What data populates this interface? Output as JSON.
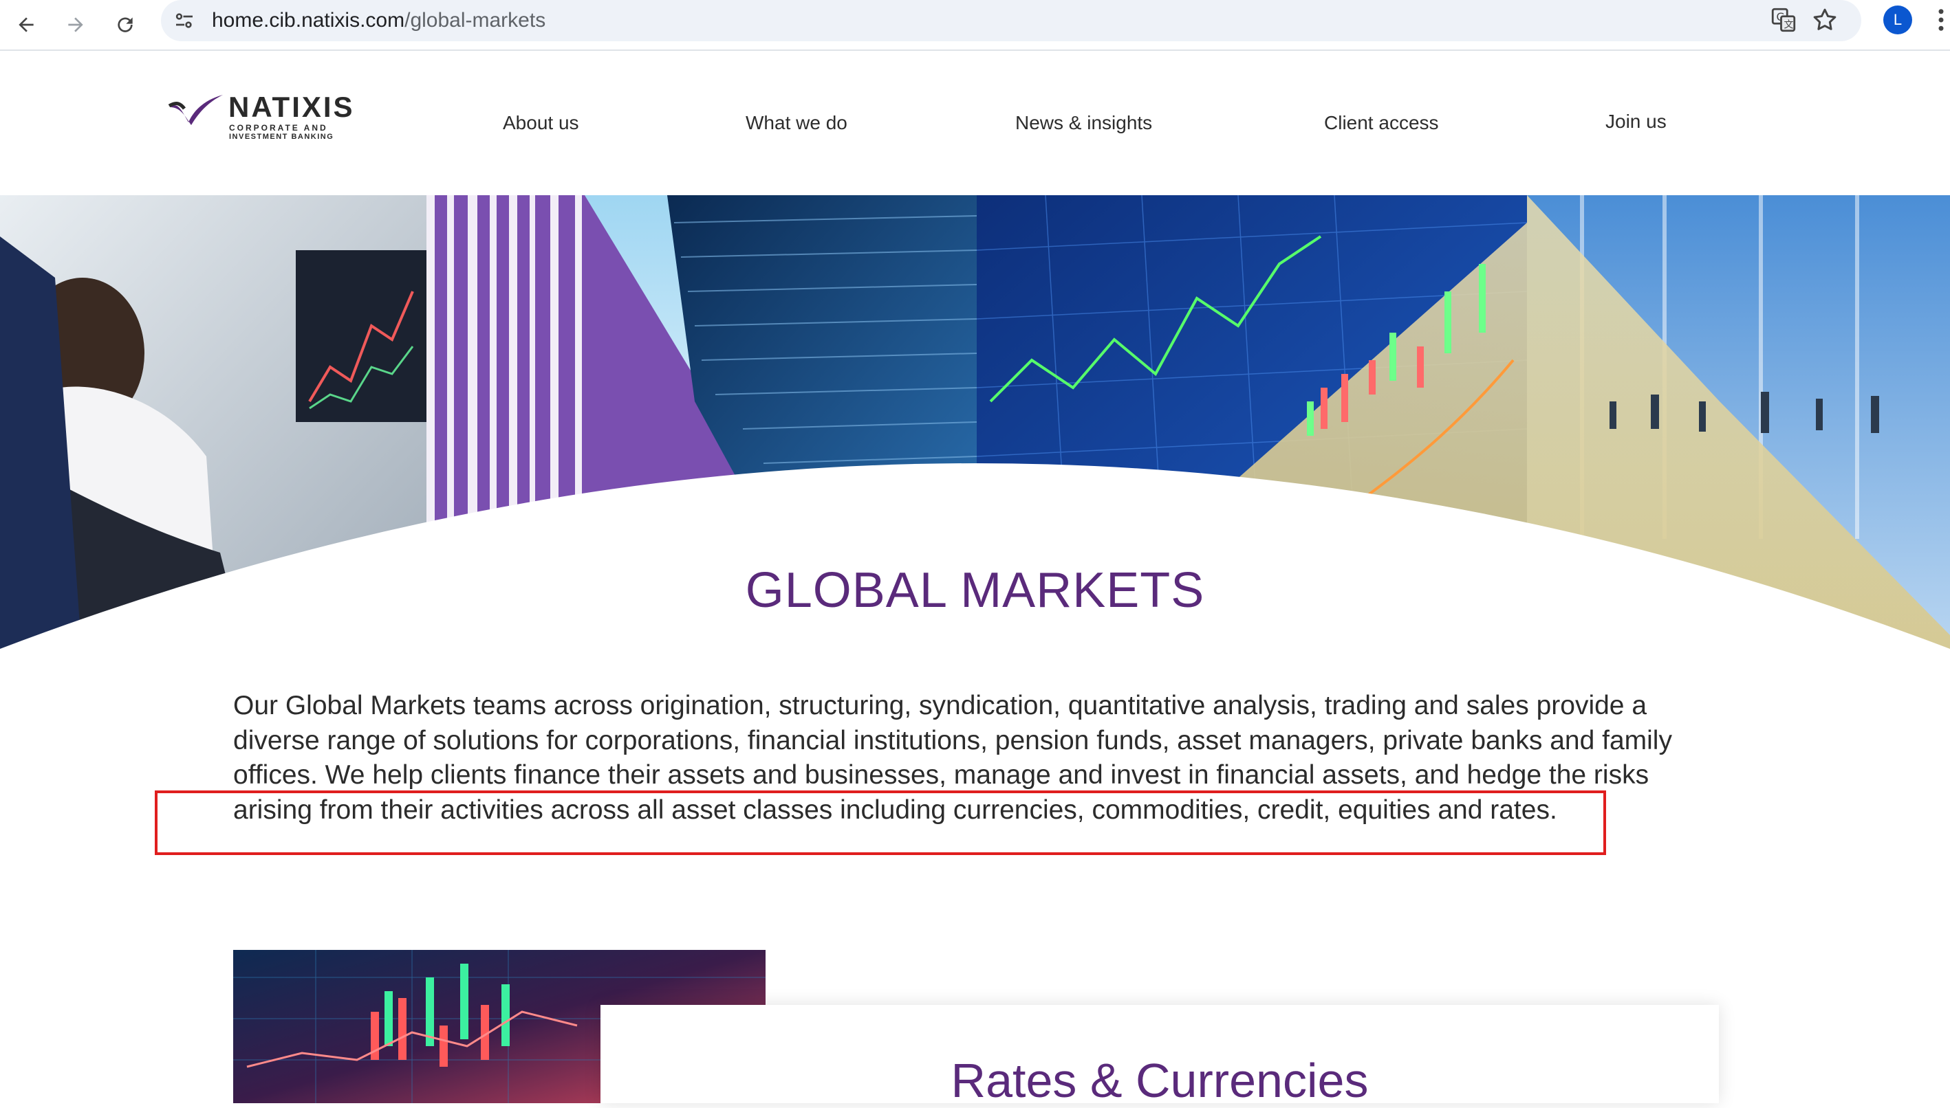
{
  "browser": {
    "url_host": "home.cib.natixis.com",
    "url_path": "/global-markets",
    "profile_initial": "L",
    "icons": [
      "back-icon",
      "forward-icon",
      "reload-icon",
      "site-info-icon",
      "translate-icon",
      "bookmark-star-icon",
      "menu-dots-icon"
    ]
  },
  "site": {
    "logo_word": "NATIXIS",
    "logo_sub_line1": "CORPORATE AND",
    "logo_sub_line2": "INVESTMENT BANKING",
    "nav": [
      "About us",
      "What we do",
      "News & insights",
      "Client access",
      "Join us"
    ]
  },
  "hero": {
    "title": "GLOBAL MARKETS"
  },
  "intro": {
    "text": "Our Global Markets teams across origination, structuring, syndication, quantitative analysis, trading and sales provide a diverse range of solutions for corporations, financial institutions, pension funds, asset managers, private banks and family offices. We help clients finance their assets and businesses, manage and invest in financial assets, and hedge the risks arising from their activities across all asset classes including currencies, commodities, credit, equities and rates."
  },
  "cards": [
    {
      "title": "Rates & Currencies"
    }
  ],
  "colors": {
    "brand_purple": "#5a2a7b",
    "highlight_red": "#e01e1e",
    "omnibox_bg": "#eef2f8",
    "profile_blue": "#0b57d0"
  }
}
